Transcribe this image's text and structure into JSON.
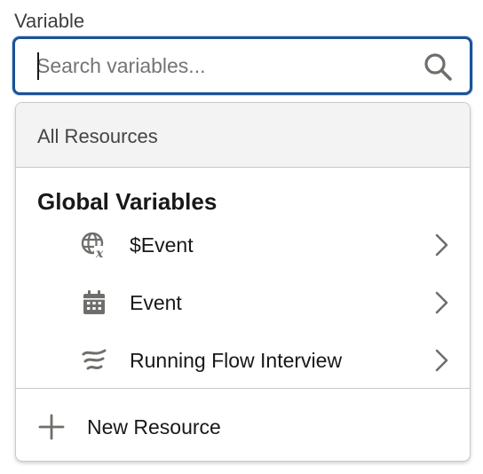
{
  "field": {
    "label": "Variable",
    "search_placeholder": "Search variables..."
  },
  "dropdown": {
    "all_resources_label": "All Resources",
    "group_heading": "Global Variables",
    "items": [
      {
        "label": "$Event",
        "icon": "global-formula-icon"
      },
      {
        "label": "Event",
        "icon": "calendar-icon"
      },
      {
        "label": "Running Flow Interview",
        "icon": "flow-icon"
      }
    ],
    "new_resource_label": "New Resource"
  },
  "colors": {
    "focus_border": "#1b5297",
    "icon_gray": "#706e6b",
    "header_bg": "#f3f3f3"
  }
}
